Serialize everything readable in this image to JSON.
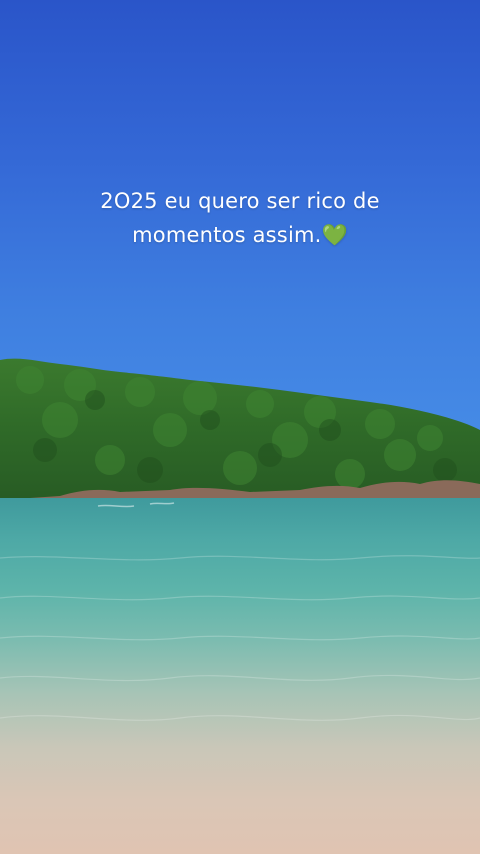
{
  "caption": {
    "line1": "2O25 eu quero ser rico de",
    "line2": "momentos assim.",
    "emoji": "💚"
  },
  "colors": {
    "sky_top": "#2a55c9",
    "sky_bottom": "#4a93ea",
    "forest": "#2f6a2a",
    "sea": "#4ea9a6",
    "sand": "#e0c4b2",
    "caption_text": "#ffffff",
    "emoji": "#5fd33a"
  }
}
